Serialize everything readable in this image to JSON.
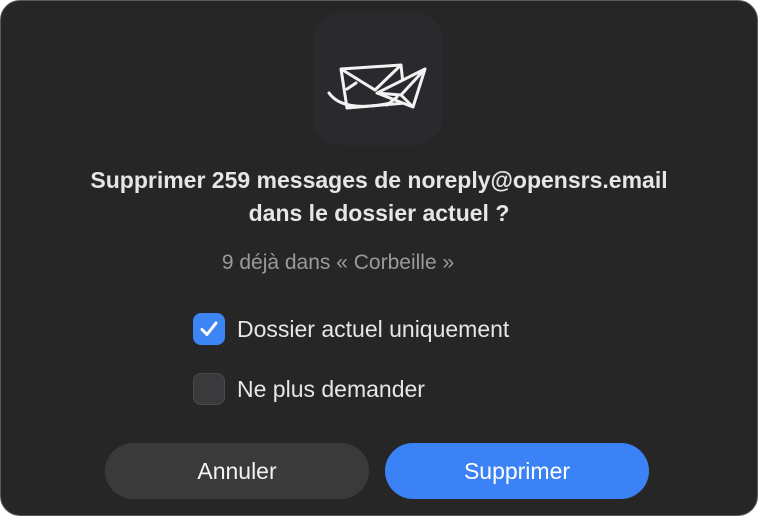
{
  "dialog": {
    "title_line1": "Supprimer 259 messages de noreply@opensrs.email",
    "title_line2": "dans le dossier actuel ?",
    "subtitle": "9 déjà dans « Corbeille »",
    "app_icon": "mail-envelopes-icon"
  },
  "options": [
    {
      "label": "Dossier actuel uniquement",
      "checked": true,
      "icon": "checkmark-icon"
    },
    {
      "label": "Ne plus demander",
      "checked": false
    }
  ],
  "buttons": {
    "cancel_label": "Annuler",
    "delete_label": "Supprimer"
  },
  "colors": {
    "dialog_bg": "#262626",
    "accent": "#3b82f6",
    "cancel_bg": "#3a3a3a",
    "text_primary": "#e6e6e6",
    "text_secondary": "#9a9a9a"
  }
}
